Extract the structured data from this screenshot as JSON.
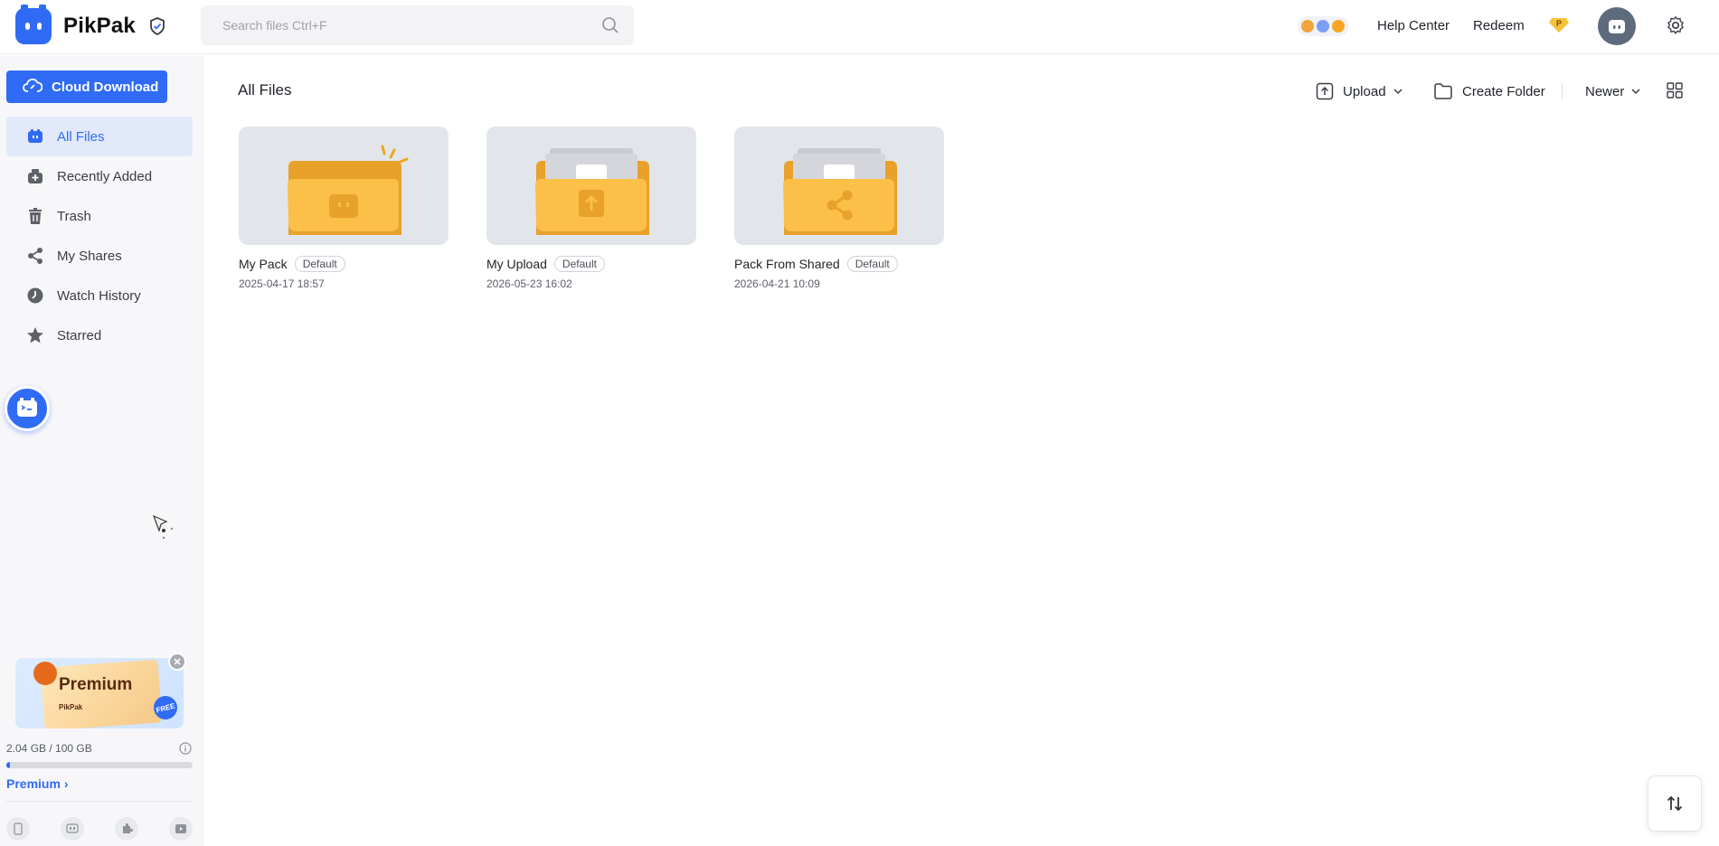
{
  "app": {
    "name": "PikPak"
  },
  "search": {
    "placeholder": "Search files Ctrl+F"
  },
  "header": {
    "help_label": "Help Center",
    "redeem_label": "Redeem",
    "p_badge": "P"
  },
  "sidebar": {
    "cloud_download_label": "Cloud Download",
    "items": [
      {
        "label": "All Files",
        "icon": "all-files-icon",
        "active": true
      },
      {
        "label": "Recently Added",
        "icon": "recently-added-icon"
      },
      {
        "label": "Trash",
        "icon": "trash-icon"
      },
      {
        "label": "My Shares",
        "icon": "share-icon"
      },
      {
        "label": "Watch History",
        "icon": "clock-icon"
      },
      {
        "label": "Starred",
        "icon": "star-icon"
      }
    ],
    "promo": {
      "title": "Premium",
      "brand": "PikPak",
      "free": "FREE"
    },
    "storage": {
      "text": "2.04 GB / 100 GB",
      "used_fraction": 0.0204
    },
    "premium_link": "Premium"
  },
  "main": {
    "title": "All Files",
    "toolbar": {
      "upload_label": "Upload",
      "create_folder_label": "Create Folder",
      "sort_label": "Newer"
    },
    "files": [
      {
        "name": "My Pack",
        "tag": "Default",
        "date": "2025-04-17 18:57",
        "kind": "pack"
      },
      {
        "name": "My Upload",
        "tag": "Default",
        "date": "2026-05-23 16:02",
        "kind": "upload"
      },
      {
        "name": "Pack From Shared",
        "tag": "Default",
        "date": "2026-04-21 10:09",
        "kind": "shared"
      }
    ]
  },
  "colors": {
    "accent": "#306bf5",
    "folder": "#fcbf47",
    "folder_dark": "#e8a12a"
  }
}
